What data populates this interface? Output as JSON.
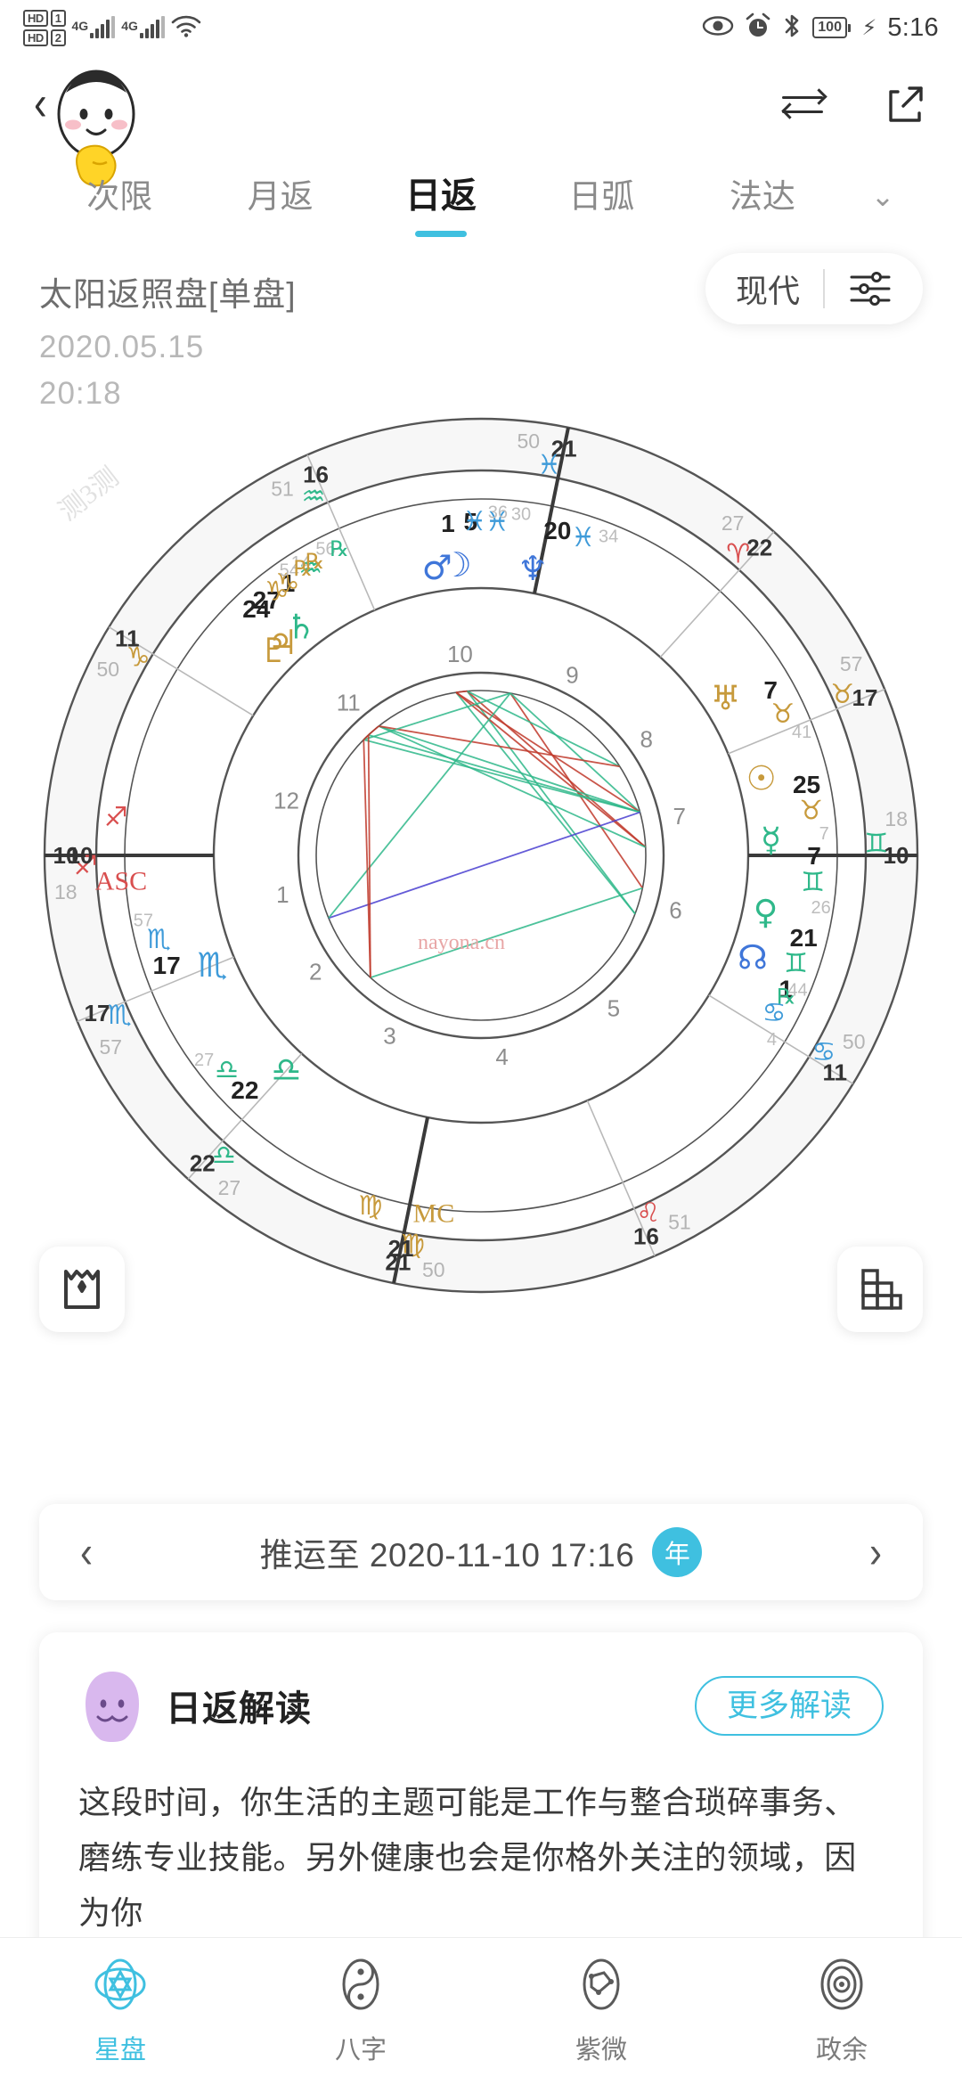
{
  "status_bar": {
    "hd1": "HD",
    "hd1_num": "1",
    "hd2": "HD",
    "hd2_num": "2",
    "network_1": "4G",
    "network_2": "4G",
    "wifi_icon": "wifi-icon",
    "eye_icon": "eye-comfort-icon",
    "alarm_icon": "alarm-icon",
    "bluetooth_icon": "bluetooth-icon",
    "battery_level": "100",
    "charging_icon": "charging-bolt-icon",
    "time": "5:16"
  },
  "header": {
    "back_icon": "back-chevron-icon",
    "dropdown_icon": "chevron-down-circle-icon",
    "swap_icon": "swap-arrows-icon",
    "share_icon": "share-export-icon",
    "sticker_name": "duck-mascot-sticker"
  },
  "tabs": {
    "items": [
      {
        "label": "次限",
        "active": false
      },
      {
        "label": "月返",
        "active": false
      },
      {
        "label": "日返",
        "active": true
      },
      {
        "label": "日弧",
        "active": false
      },
      {
        "label": "法达",
        "active": false
      }
    ],
    "expand_icon": "chevron-down-icon",
    "accent_color": "#3fc0e0"
  },
  "chart_header": {
    "title": "太阳返照盘[单盘]",
    "date": "2020.05.15",
    "time": "20:18",
    "mode_label": "现代",
    "settings_icon": "sliders-settings-icon"
  },
  "wheel": {
    "watermark_left": "测3测",
    "watermark_center": "nayona.cn",
    "corner_left_icon": "shirt-icon",
    "corner_right_icon": "bar-grid-icon",
    "axes": [
      {
        "name": "ASC",
        "deg": "10",
        "sign": "♐",
        "sign_name": "sagittarius",
        "min": "18",
        "color": "#d94f4f"
      },
      {
        "name": "MC",
        "deg": "21",
        "sign": "♍",
        "sign_name": "virgo",
        "min": "50",
        "color": "#c79a3c"
      }
    ],
    "house_cusps": [
      {
        "house": 10,
        "deg": "21",
        "sign": "♍",
        "min": "50",
        "color": "#c79a3c"
      },
      {
        "house": 11,
        "deg": "16",
        "sign": "♌",
        "min": "51",
        "color": "#d94f4f"
      },
      {
        "house": 12,
        "deg": "11",
        "sign": "♋",
        "min": "50",
        "color": "#3f9bd9"
      },
      {
        "house": 1,
        "deg": "10",
        "sign": "♊",
        "min": "18",
        "color": "#2fb88a"
      },
      {
        "house": 2,
        "deg": "17",
        "sign": "♉",
        "min": "57",
        "color": "#c79a3c"
      },
      {
        "house": 3,
        "deg": "22",
        "sign": "♈",
        "min": "27",
        "color": "#d94f4f"
      },
      {
        "house": 4,
        "deg": "21",
        "sign": "♓",
        "min": "50",
        "color": "#3f9bd9"
      },
      {
        "house": 5,
        "deg": "16",
        "sign": "♒",
        "min": "51",
        "color": "#2fb88a"
      },
      {
        "house": 6,
        "deg": "11",
        "sign": "♑",
        "min": "50",
        "color": "#c79a3c"
      },
      {
        "house": 7,
        "deg": "10",
        "sign": "♐",
        "min": "18",
        "color": "#d94f4f"
      },
      {
        "house": 8,
        "deg": "17",
        "sign": "♏",
        "min": "57",
        "color": "#3f9bd9"
      },
      {
        "house": 9,
        "deg": "22",
        "sign": "♎",
        "min": "27",
        "color": "#2fb88a"
      }
    ],
    "planets": [
      {
        "name": "north-node",
        "glyph": "☊",
        "deg": "1",
        "sign": "♋",
        "min": "4",
        "retro": false,
        "color": "#3f76d9",
        "sign_color": "#3f9bd9"
      },
      {
        "name": "venus",
        "glyph": "♀",
        "deg": "21",
        "sign": "♊",
        "min": "44",
        "retro": true,
        "color": "#2fb88a",
        "sign_color": "#2fb88a"
      },
      {
        "name": "mercury",
        "glyph": "☿",
        "deg": "7",
        "sign": "♊",
        "min": "26",
        "retro": false,
        "color": "#2fb88a",
        "sign_color": "#2fb88a"
      },
      {
        "name": "sun",
        "glyph": "☉",
        "deg": "25",
        "sign": "♉",
        "min": "7",
        "retro": false,
        "color": "#c79a3c",
        "sign_color": "#c79a3c"
      },
      {
        "name": "uranus",
        "glyph": "♅",
        "deg": "7",
        "sign": "♉",
        "min": "41",
        "retro": false,
        "color": "#c79a3c",
        "sign_color": "#c79a3c"
      },
      {
        "name": "neptune",
        "glyph": "♆",
        "deg": "20",
        "sign": "♓",
        "min": "34",
        "retro": false,
        "color": "#3f76d9",
        "sign_color": "#3f9bd9"
      },
      {
        "name": "moon",
        "glyph": "☽",
        "deg": "5",
        "sign": "♓",
        "min": "30",
        "retro": false,
        "color": "#3f76d9",
        "sign_color": "#3f9bd9"
      },
      {
        "name": "mars",
        "glyph": "♂",
        "deg": "1",
        "sign": "♓",
        "min": "36",
        "retro": false,
        "color": "#3f76d9",
        "sign_color": "#3f9bd9"
      },
      {
        "name": "saturn",
        "glyph": "♄",
        "deg": "1",
        "sign": "♒",
        "min": "56",
        "retro": true,
        "color": "#2fb88a",
        "sign_color": "#2fb88a"
      },
      {
        "name": "jupiter",
        "glyph": "♃",
        "deg": "27",
        "sign": "♑",
        "min": "14",
        "retro": true,
        "color": "#c79a3c",
        "sign_color": "#c79a3c"
      },
      {
        "name": "pluto",
        "glyph": "♇",
        "deg": "24",
        "sign": "♑",
        "min": "54",
        "retro": true,
        "color": "#c79a3c",
        "sign_color": "#c79a3c"
      },
      {
        "name": "libra-cusp",
        "glyph": "♎",
        "deg": "22",
        "sign": "♎",
        "min": "27",
        "retro": false,
        "color": "#2fb88a",
        "sign_color": "#2fb88a"
      },
      {
        "name": "scorpio-cusp",
        "glyph": "♏",
        "deg": "17",
        "sign": "♏",
        "min": "57",
        "retro": false,
        "color": "#3f9bd9",
        "sign_color": "#3f9bd9"
      }
    ],
    "house_numbers": [
      "1",
      "2",
      "3",
      "4",
      "5",
      "6",
      "7",
      "8",
      "9",
      "10",
      "11",
      "12"
    ]
  },
  "date_nav": {
    "prev_icon": "chevron-left-icon",
    "next_icon": "chevron-right-icon",
    "label": "推运至 2020-11-10 17:16",
    "badge": "年"
  },
  "interpretation": {
    "avatar_icon": "purple-ghost-avatar",
    "title": "日返解读",
    "more_label": "更多解读",
    "body": "这段时间，你生活的主题可能是工作与整合琐碎事务、磨练专业技能。另外健康也会是你格外关注的领域，因为你"
  },
  "bottom_nav": {
    "items": [
      {
        "label": "星盘",
        "icon": "star-chart-icon",
        "active": true
      },
      {
        "label": "八字",
        "icon": "yin-yang-icon",
        "active": false
      },
      {
        "label": "紫微",
        "icon": "ziwei-constellation-icon",
        "active": false
      },
      {
        "label": "政余",
        "icon": "target-rings-icon",
        "active": false
      }
    ],
    "active_color": "#3fc0e0"
  }
}
